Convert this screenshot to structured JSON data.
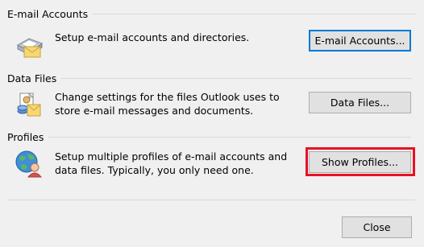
{
  "email_accounts": {
    "title": "E-mail Accounts",
    "description": "Setup e-mail accounts and directories.",
    "button_label": "E-mail Accounts..."
  },
  "data_files": {
    "title": "Data Files",
    "description_line1": "Change settings for the files Outlook uses to",
    "description_line2": "store e-mail messages and documents.",
    "button_label": "Data Files..."
  },
  "profiles": {
    "title": "Profiles",
    "description_line1": "Setup multiple profiles of e-mail accounts and",
    "description_line2": "data files. Typically, you only need one.",
    "button_label": "Show Profiles..."
  },
  "footer": {
    "close_label": "Close"
  },
  "colors": {
    "highlight": "#e81123",
    "focus_border": "#0078d7",
    "background": "#f0f0f0"
  },
  "icons": [
    "email-accounts-icon",
    "data-files-icon",
    "profiles-icon"
  ]
}
